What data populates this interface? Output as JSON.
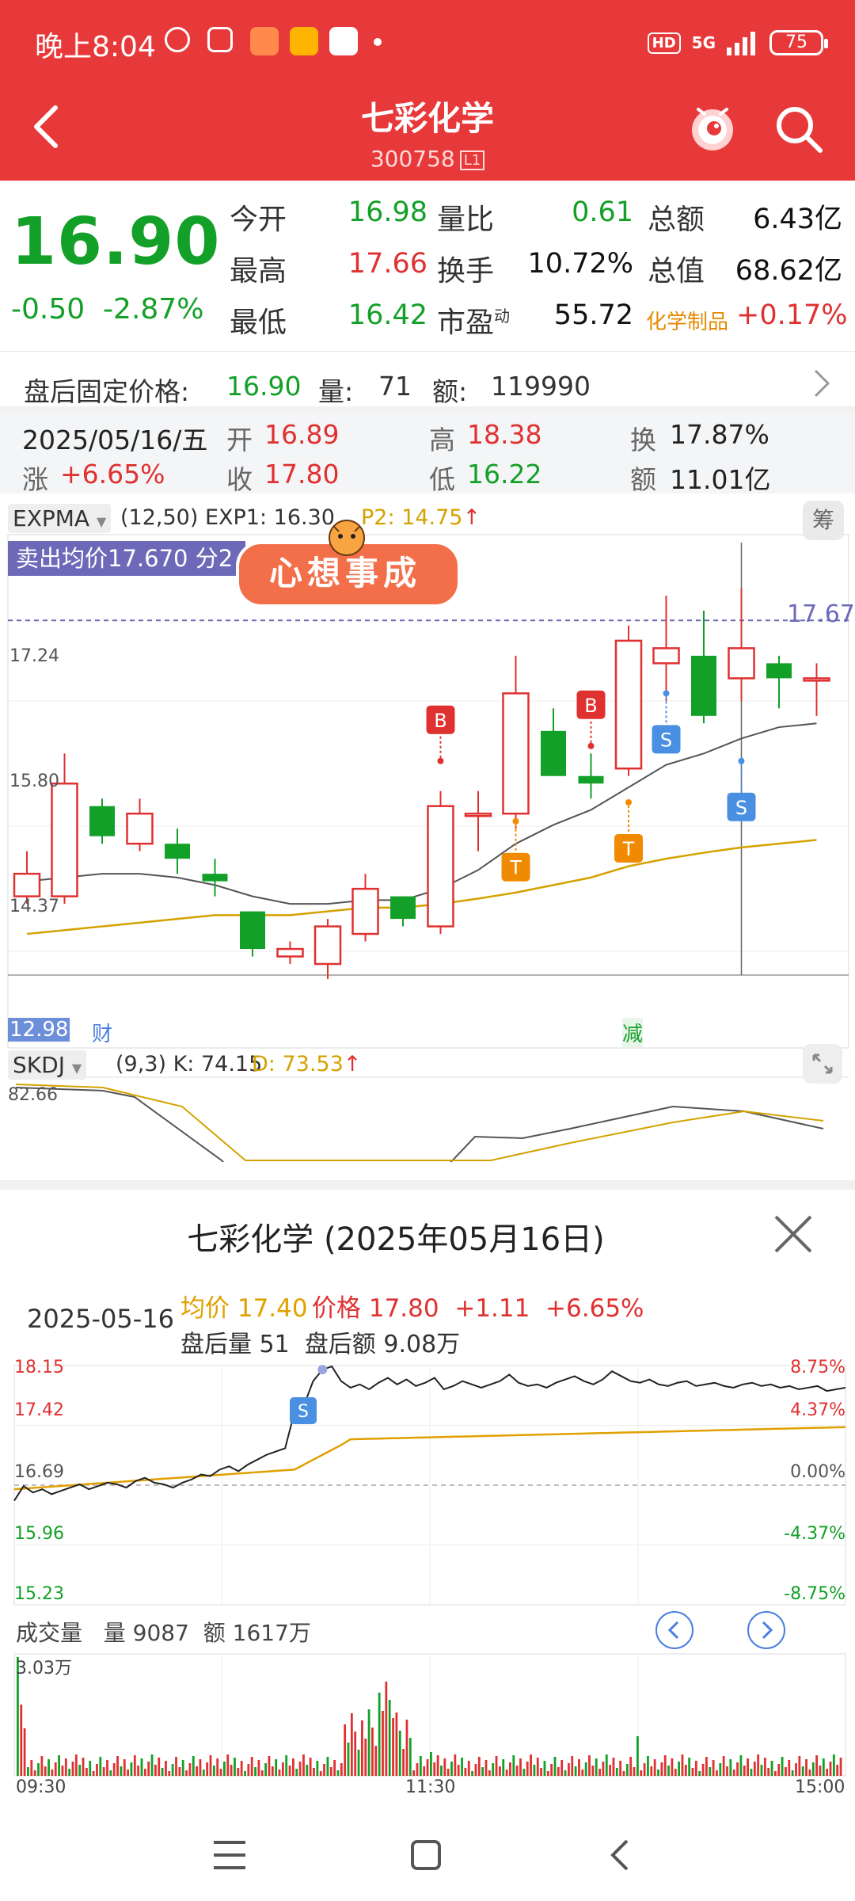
{
  "status": {
    "time": "晚上8:04",
    "network": "5G",
    "hd": "HD",
    "battery": "75"
  },
  "header": {
    "title": "七彩化学",
    "code": "300758",
    "code_badge": "L1"
  },
  "quote": {
    "price": "16.90",
    "change": "-0.50",
    "change_pct": "-2.87%",
    "fields": [
      {
        "label": "今开",
        "value": "16.98",
        "color": "green"
      },
      {
        "label": "量比",
        "value": "0.61",
        "color": "green"
      },
      {
        "label": "总额",
        "value": "6.43亿",
        "color": "black"
      },
      {
        "label": "最高",
        "value": "17.66",
        "color": "red"
      },
      {
        "label": "换手",
        "value": "10.72%",
        "color": "black"
      },
      {
        "label": "总值",
        "value": "68.62亿",
        "color": "black"
      },
      {
        "label": "最低",
        "value": "16.42",
        "color": "green"
      },
      {
        "label": "市盈",
        "label_sup": "动",
        "value": "55.72",
        "color": "black"
      },
      {
        "label": "化学制品",
        "value": "+0.17%",
        "color": "red"
      }
    ]
  },
  "after_hours": {
    "label": "盘后固定价格:",
    "price": "16.90",
    "vol_label": "量:",
    "vol": "71",
    "amt_label": "额:",
    "amt": "119990"
  },
  "day_info": {
    "date": "2025/05/16/五",
    "open_label": "开",
    "open": "16.89",
    "high_label": "高",
    "high": "18.38",
    "turn_label": "换",
    "turn": "17.87%",
    "rise_label": "涨",
    "rise": "+6.65%",
    "close_label": "收",
    "close": "17.80",
    "low_label": "低",
    "low": "16.22",
    "amt_label": "额",
    "amt": "11.01亿"
  },
  "kline": {
    "indicator": "EXPMA",
    "params": "(12,50) EXP1: 16.30",
    "exp2": "P2: 14.75",
    "sell_banner": "卖出均价17.670 分2笔",
    "sticker_text": "心想事成",
    "chip_label": "筹",
    "y_labels": [
      "17.24",
      "15.80",
      "14.37",
      "12.98"
    ],
    "cursor_price": "17.67",
    "marker_cai": "财",
    "marker_jian": "减",
    "signals": [
      {
        "label": "B",
        "color": "#e03131"
      },
      {
        "label": "B",
        "color": "#e03131"
      },
      {
        "label": "S",
        "color": "#4a90e2"
      },
      {
        "label": "S",
        "color": "#4a90e2"
      },
      {
        "label": "T",
        "color": "#f08a00"
      },
      {
        "label": "T",
        "color": "#f08a00"
      }
    ],
    "candles": [
      {
        "o": 14.0,
        "c": 14.3,
        "h": 14.6,
        "l": 13.9
      },
      {
        "o": 14.0,
        "c": 15.5,
        "h": 15.9,
        "l": 13.9
      },
      {
        "o": 15.2,
        "c": 14.8,
        "h": 15.3,
        "l": 14.7
      },
      {
        "o": 14.7,
        "c": 15.1,
        "h": 15.3,
        "l": 14.6
      },
      {
        "o": 14.7,
        "c": 14.5,
        "h": 14.9,
        "l": 14.3
      },
      {
        "o": 14.3,
        "c": 14.2,
        "h": 14.5,
        "l": 14.0
      },
      {
        "o": 13.8,
        "c": 13.3,
        "h": 13.8,
        "l": 13.2
      },
      {
        "o": 13.2,
        "c": 13.3,
        "h": 13.4,
        "l": 13.1
      },
      {
        "o": 13.1,
        "c": 13.6,
        "h": 13.7,
        "l": 12.9
      },
      {
        "o": 13.5,
        "c": 14.1,
        "h": 14.3,
        "l": 13.4
      },
      {
        "o": 14.0,
        "c": 13.7,
        "h": 14.0,
        "l": 13.6
      },
      {
        "o": 13.6,
        "c": 15.2,
        "h": 15.4,
        "l": 13.5
      },
      {
        "o": 15.1,
        "c": 15.1,
        "h": 15.4,
        "l": 14.6
      },
      {
        "o": 15.1,
        "c": 16.7,
        "h": 17.2,
        "l": 14.9
      },
      {
        "o": 16.2,
        "c": 15.6,
        "h": 16.5,
        "l": 15.6
      },
      {
        "o": 15.6,
        "c": 15.5,
        "h": 15.9,
        "l": 15.3
      },
      {
        "o": 15.7,
        "c": 17.4,
        "h": 17.6,
        "l": 15.6
      },
      {
        "o": 17.1,
        "c": 17.3,
        "h": 18.0,
        "l": 16.6
      },
      {
        "o": 17.2,
        "c": 16.4,
        "h": 17.8,
        "l": 16.3
      },
      {
        "o": 16.9,
        "c": 17.3,
        "h": 18.1,
        "l": 16.6
      },
      {
        "o": 17.1,
        "c": 16.9,
        "h": 17.2,
        "l": 16.5
      },
      {
        "o": 16.9,
        "c": 16.9,
        "h": 17.1,
        "l": 16.4
      }
    ],
    "ma_gray": [
      14.2,
      14.25,
      14.3,
      14.3,
      14.25,
      14.15,
      14.0,
      13.9,
      13.9,
      13.95,
      13.95,
      14.1,
      14.35,
      14.7,
      14.95,
      15.15,
      15.45,
      15.75,
      15.9,
      16.1,
      16.25,
      16.3
    ],
    "ma_gold": [
      13.5,
      13.55,
      13.6,
      13.65,
      13.7,
      13.75,
      13.75,
      13.75,
      13.8,
      13.85,
      13.85,
      13.9,
      13.97,
      14.05,
      14.15,
      14.25,
      14.4,
      14.5,
      14.58,
      14.65,
      14.7,
      14.75
    ]
  },
  "kdj": {
    "indicator": "SKDJ",
    "params": "(9,3) K: 74.15",
    "d_value": "D: 73.53",
    "y_top": "82.66"
  },
  "intraday": {
    "title": "七彩化学 (2025年05月16日)",
    "date": "2025-05-16",
    "avg_label": "均价",
    "avg": "17.40",
    "price_label": "价格",
    "price": "17.80",
    "change": "+1.11",
    "change_pct": "+6.65%",
    "ah_vol_label": "盘后量",
    "ah_vol": "51",
    "ah_amt_label": "盘后额",
    "ah_amt": "9.08万",
    "y_left": [
      "18.15",
      "17.42",
      "16.69",
      "15.96",
      "15.23"
    ],
    "y_right": [
      "8.75%",
      "4.37%",
      "0.00%",
      "-4.37%",
      "-8.75%"
    ],
    "signal_s": "S",
    "volume_label": "成交量",
    "vol_label": "量",
    "vol": "9087",
    "amt_label": "额",
    "amt": "1617万",
    "vol_max": "3.03万",
    "times": [
      "09:30",
      "11:30",
      "15:00"
    ]
  },
  "colors": {
    "brand": "#e8393a",
    "up": "#e03131",
    "down": "#13a028",
    "gold": "#e0a800"
  }
}
